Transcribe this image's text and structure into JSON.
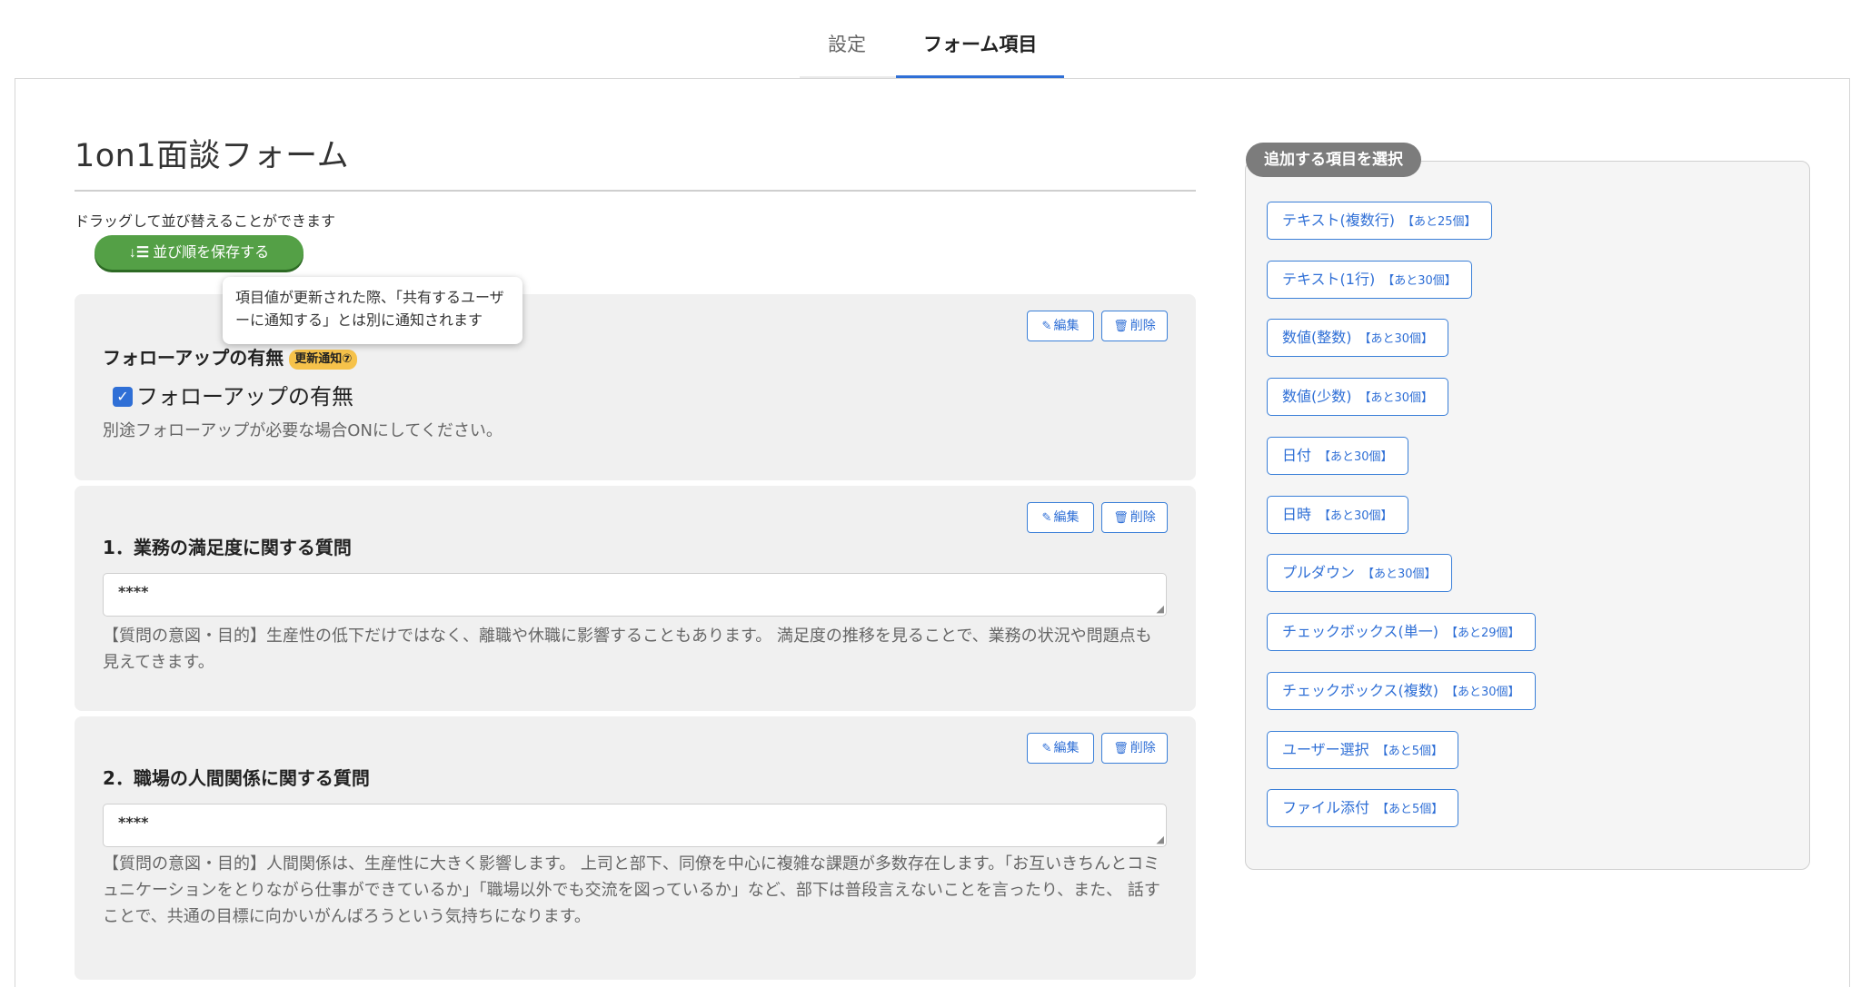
{
  "tabs": [
    {
      "label": "設定",
      "active": false
    },
    {
      "label": "フォーム項目",
      "active": true
    }
  ],
  "form": {
    "title": "1on1面談フォーム",
    "drag_hint": "ドラッグして並び替えることができます",
    "save_order_label": "並び順を保存する"
  },
  "tooltip": "項目値が更新された際、「共有するユーザーに通知する」とは別に通知されます",
  "actions": {
    "edit_label": "編集",
    "delete_label": "削除"
  },
  "items": [
    {
      "title": "フォローアップの有無",
      "badge": "更新通知⑦",
      "checkbox_label": "フォローアップの有無",
      "checked": true,
      "description": "別途フォローアップが必要な場合ONにしてください。"
    },
    {
      "title": "1．業務の満足度に関する質問",
      "value": "****",
      "description": "【質問の意図・目的】生産性の低下だけではなく、離職や休職に影響することもあります。 満足度の推移を見ることで、業務の状況や問題点も見えてきます。"
    },
    {
      "title": "2．職場の人間関係に関する質問",
      "value": "****",
      "description": "【質問の意図・目的】人間関係は、生産性に大きく影響します。 上司と部下、同僚を中心に複雑な課題が多数存在します。「お互いきちんとコミュニケーションをとりながら仕事ができているか」「職場以外でも交流を図っているか」など、部下は普段言えないことを言ったり、また、 話すことで、共通の目標に向かいがんばろうという気持ちになります。"
    }
  ],
  "picker": {
    "label": "追加する項目を選択",
    "options": [
      {
        "label": "テキスト(複数行)",
        "remaining": "【あと25個】"
      },
      {
        "label": "テキスト(1行)",
        "remaining": "【あと30個】"
      },
      {
        "label": "数値(整数)",
        "remaining": "【あと30個】"
      },
      {
        "label": "数値(少数)",
        "remaining": "【あと30個】"
      },
      {
        "label": "日付",
        "remaining": "【あと30個】"
      },
      {
        "label": "日時",
        "remaining": "【あと30個】"
      },
      {
        "label": "プルダウン",
        "remaining": "【あと30個】"
      },
      {
        "label": "チェックボックス(単一)",
        "remaining": "【あと29個】"
      },
      {
        "label": "チェックボックス(複数)",
        "remaining": "【あと30個】"
      },
      {
        "label": "ユーザー選択",
        "remaining": "【あと5個】"
      },
      {
        "label": "ファイル添付",
        "remaining": "【あと5個】"
      }
    ]
  },
  "colors": {
    "accent": "#2f6fd6",
    "save_button": "#54a046",
    "badge": "#f6c24a",
    "picker_label": "#7c7c7c"
  },
  "icons": {
    "save": "sort-icon",
    "edit": "edit-icon",
    "delete": "trash-icon",
    "check": "checkmark-icon"
  }
}
